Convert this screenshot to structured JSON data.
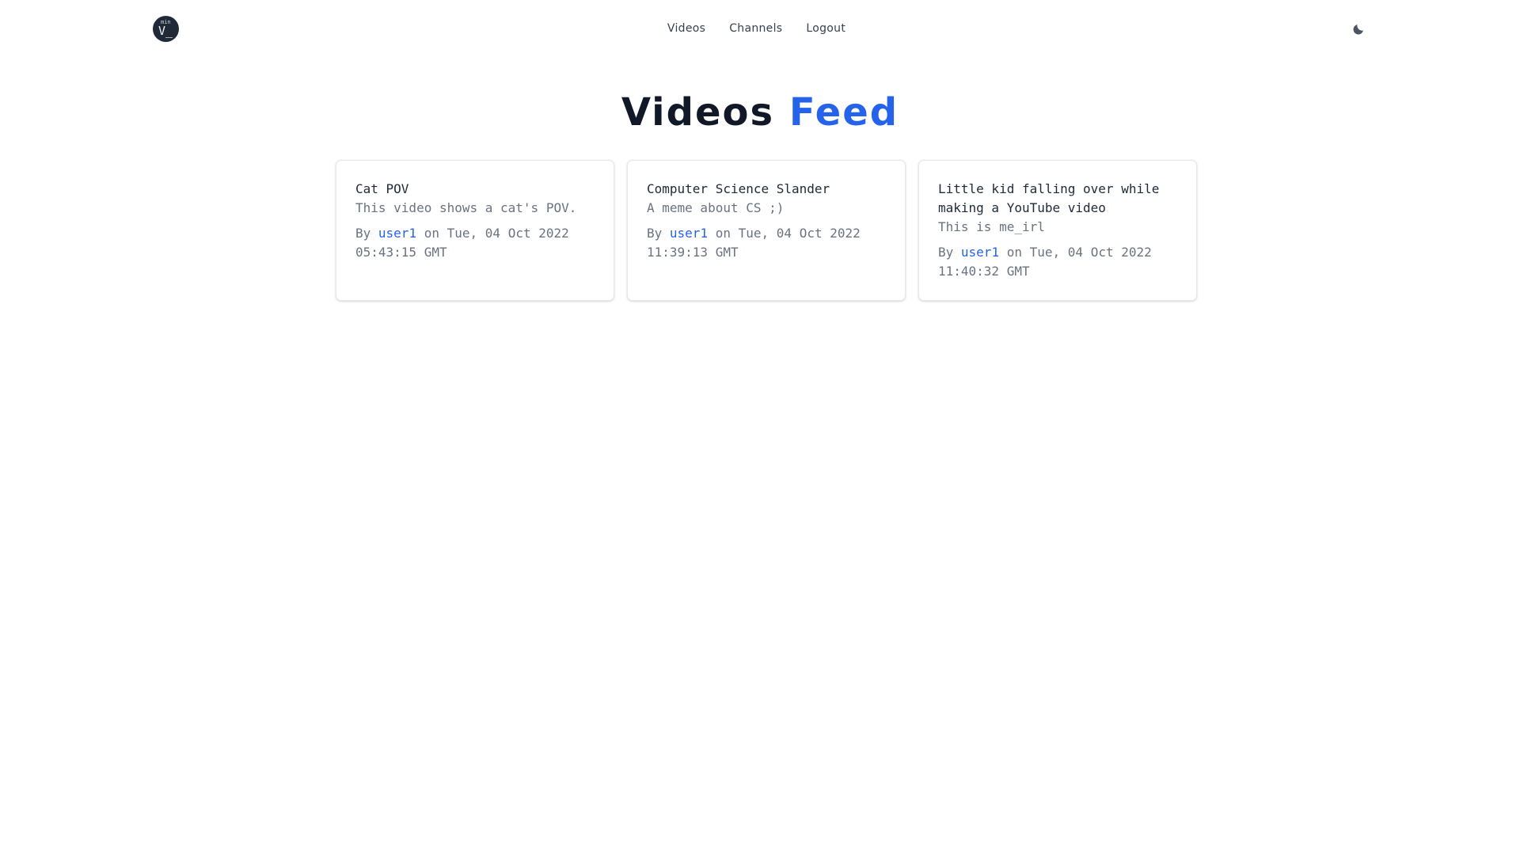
{
  "nav": {
    "logo": {
      "sup": "min",
      "main": "V_"
    },
    "links": [
      "Videos",
      "Channels",
      "Logout"
    ],
    "theme_toggle_icon": "moon-icon"
  },
  "heading": {
    "main": "Videos",
    "accent": "Feed"
  },
  "colors": {
    "accent": "#2563eb",
    "text": "#111827",
    "muted": "#6b7280"
  },
  "feed": {
    "by_label": "By",
    "on_label": "on",
    "videos": [
      {
        "title": "Cat POV",
        "description": "This video shows a cat's POV.",
        "author": "user1",
        "date": "Tue, 04 Oct 2022 05:43:15 GMT"
      },
      {
        "title": "Computer Science Slander",
        "description": "A meme about CS ;)",
        "author": "user1",
        "date": "Tue, 04 Oct 2022 11:39:13 GMT"
      },
      {
        "title": "Little kid falling over while making a YouTube video",
        "description": "This is me_irl",
        "author": "user1",
        "date": "Tue, 04 Oct 2022 11:40:32 GMT"
      }
    ]
  }
}
